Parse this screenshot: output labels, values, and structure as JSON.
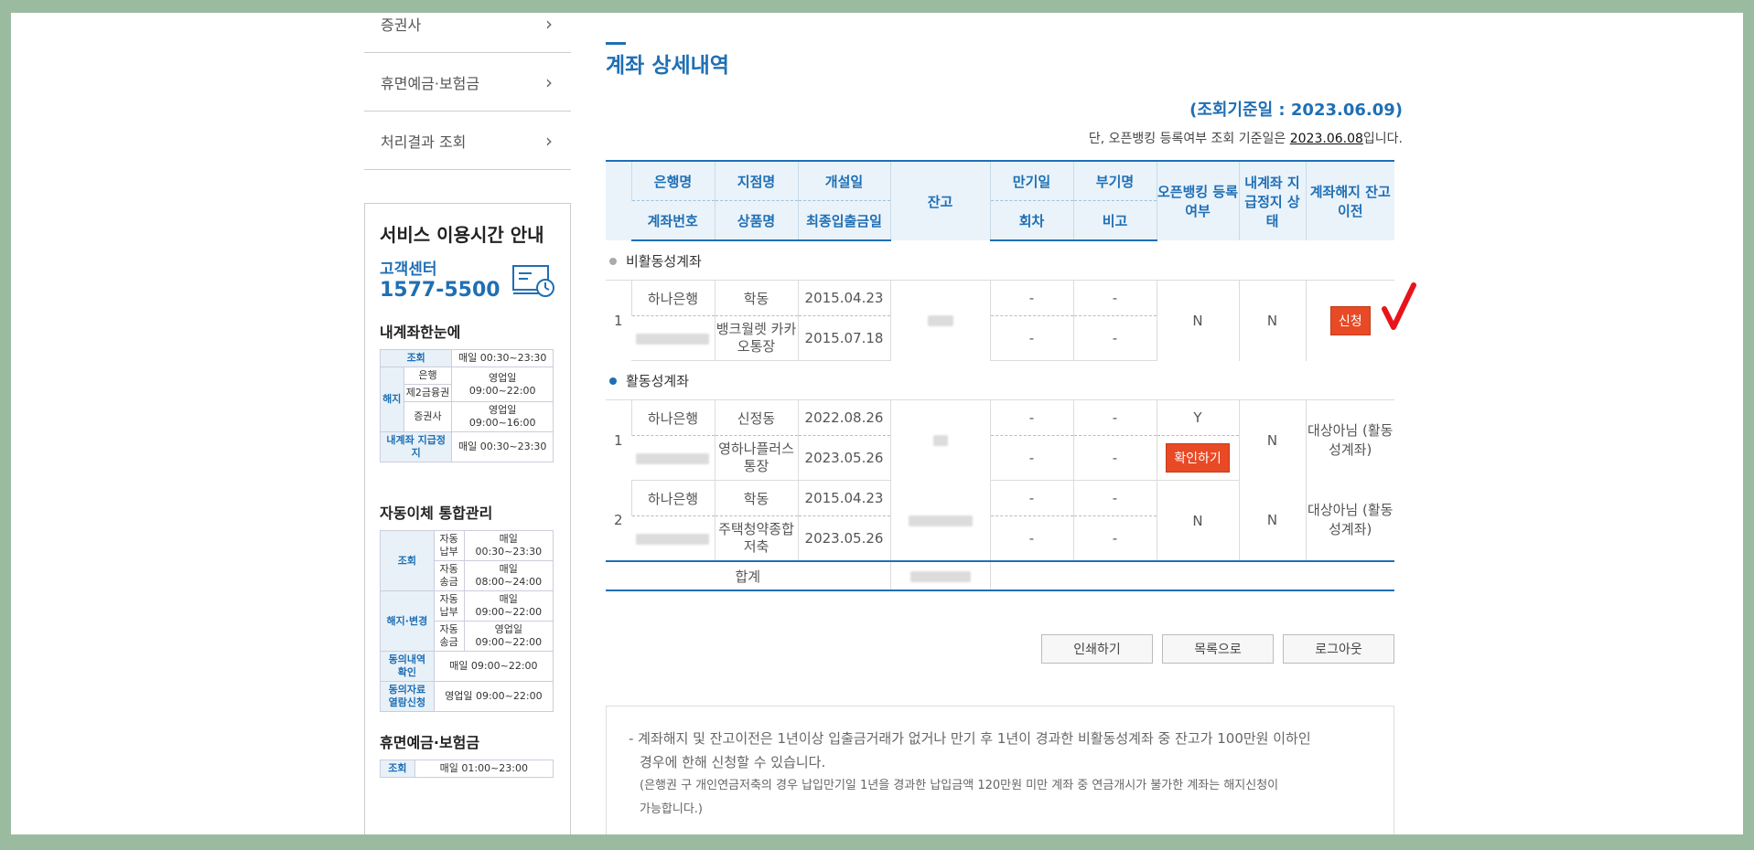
{
  "sidebar": {
    "items": [
      {
        "label": "증권사"
      },
      {
        "label": "휴면예금·보험금"
      },
      {
        "label": "처리결과 조회"
      }
    ],
    "chevron_icon": "chevron-right-icon"
  },
  "service": {
    "title": "서비스 이용시간 안내",
    "cc_label": "고객센터",
    "cc_number": "1577-5500",
    "section1": {
      "title": "내계좌한눈에",
      "lookup": "조회",
      "lookup_time": "매일 00:30~23:30",
      "cancel": "해지",
      "bank": "은행",
      "second_fin": "제2금융권",
      "bank_time": "영업일 09:00~22:00",
      "securities": "증권사",
      "securities_time": "영업일 09:00~16:00",
      "stop": "내계좌 지급정지",
      "stop_time": "매일 00:30~23:30"
    },
    "section2": {
      "title": "자동이체 통합관리",
      "lookup": "조회",
      "auto_pay": "자동납부",
      "auto_pay_time": "매일 00:30~23:30",
      "auto_send": "자동송금",
      "auto_send_time": "매일 08:00~24:00",
      "change": "해지·변경",
      "change_pay": "자동납부",
      "change_pay_time": "매일 09:00~22:00",
      "change_send": "자동송금",
      "change_send_time": "영업일 09:00~22:00",
      "consent_check": "동의내역 확인",
      "consent_check_time": "매일 09:00~22:00",
      "consent_view": "동의자료 열람신청",
      "consent_view_time": "영업일 09:00~22:00"
    },
    "section3": {
      "title": "휴면예금·보험금",
      "lookup": "조회",
      "lookup_time": "매일 01:00~23:00"
    }
  },
  "main": {
    "title": "계좌 상세내역",
    "base_date": "(조회기준일 : 2023.06.09)",
    "note_prefix": "단, 오픈뱅킹 등록여부 조회 기준일은 ",
    "note_date": "2023.06.08",
    "note_suffix": "입니다.",
    "headers": {
      "bank": "은행명",
      "acct_no": "계좌번호",
      "branch": "지점명",
      "product": "상품명",
      "open_date": "개설일",
      "last_date": "최종입출금일",
      "balance": "잔고",
      "maturity": "만기일",
      "round": "회차",
      "ledger": "부기명",
      "remark": "비고",
      "openbanking": "오픈뱅킹 등록여부",
      "stop_status": "내계좌 지급정지 상태",
      "transfer": "계좌해지 잔고이전"
    },
    "sections": {
      "inactive": "비활동성계좌",
      "active": "활동성계좌"
    },
    "inactive_rows": [
      {
        "no": "1",
        "bank": "하나은행",
        "branch": "학동",
        "product": "뱅크월렛 카카오통장",
        "open_date": "2015.04.23",
        "last_date": "2015.07.18",
        "maturity": "-",
        "round": "-",
        "ledger": "-",
        "remark": "-",
        "openbanking": "N",
        "stop": "N",
        "action": "신청"
      }
    ],
    "active_rows": [
      {
        "no": "1",
        "bank": "하나은행",
        "branch": "신정동",
        "product": "영하나플러스통장",
        "open_date": "2022.08.26",
        "last_date": "2023.05.26",
        "maturity": "-",
        "round": "-",
        "ledger": "-",
        "remark": "-",
        "openbanking": "Y",
        "confirm": "확인하기",
        "stop": "N",
        "transfer": "대상아님 (활동성계좌)"
      },
      {
        "no": "2",
        "bank": "하나은행",
        "branch": "학동",
        "product": "주택청약종합저축",
        "open_date": "2015.04.23",
        "last_date": "2023.05.26",
        "maturity": "-",
        "round": "-",
        "ledger": "-",
        "remark": "-",
        "openbanking": "N",
        "stop": "N",
        "transfer": "대상아님 (활동성계좌)"
      }
    ],
    "total_label": "합계",
    "buttons": {
      "print": "인쇄하기",
      "list": "목록으로",
      "logout": "로그아웃"
    },
    "notice_line1": "- 계좌해지 및 잔고이전은 1년이상 입출금거래가 없거나 만기 후 1년이 경과한 비활동성계좌 중 잔고가 100만원 이하인",
    "notice_line2": "경우에 한해 신청할 수 있습니다.",
    "notice_line3": "(은행권 구 개인연금저축의 경우 납입만기일 1년을 경과한 납입금액 120만원 미만 계좌 중 연금개시가 불가한 계좌는 해지신청이",
    "notice_line4": "가능합니다.)"
  },
  "colors": {
    "accent": "#1f6fb5",
    "button_red": "#e84a26",
    "check_red": "#e8141c",
    "frame": "#9bbba0"
  },
  "annotation": {
    "icon": "checkmark-icon"
  }
}
